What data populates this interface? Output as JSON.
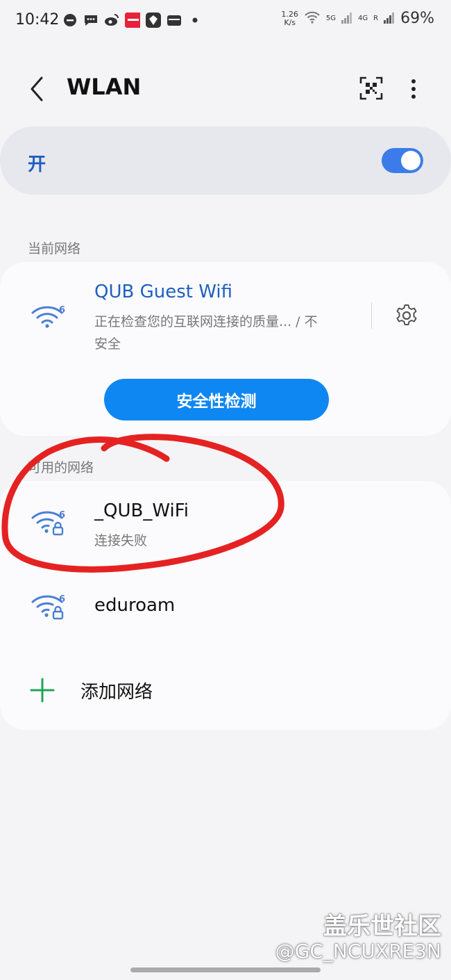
{
  "status_bar": {
    "time": "10:42",
    "speed_value": "1.26",
    "speed_unit": "K/s",
    "net_5g": "5G",
    "net_4g": "4G",
    "roaming": "R",
    "battery": "69%"
  },
  "header": {
    "title": "WLAN",
    "icons": [
      "back-arrow-icon",
      "qr-scan-icon",
      "more-vert-icon"
    ]
  },
  "toggle": {
    "label": "开",
    "state": "on",
    "accent": "#3c7cea"
  },
  "current_network": {
    "section_label": "当前网络",
    "name": "QUB Guest Wifi",
    "status_line1": "正在检查您的互联网连接的质量... / 不",
    "status_line2": "安全",
    "wifi_badge": "6",
    "check_button_label": "安全性检测",
    "button_color": "#0f87f2"
  },
  "available": {
    "section_label": "可用的网络",
    "networks": [
      {
        "name": "_QUB_WiFi",
        "status": "连接失败",
        "wifi_badge": "6"
      },
      {
        "name": "eduroam",
        "wifi_badge": "6"
      }
    ],
    "add_label": "添加网络"
  },
  "annotation": {
    "color": "#e52222"
  },
  "watermark": {
    "line1": "盖乐世社区",
    "line2": "@GC_NCUXRE3N"
  }
}
